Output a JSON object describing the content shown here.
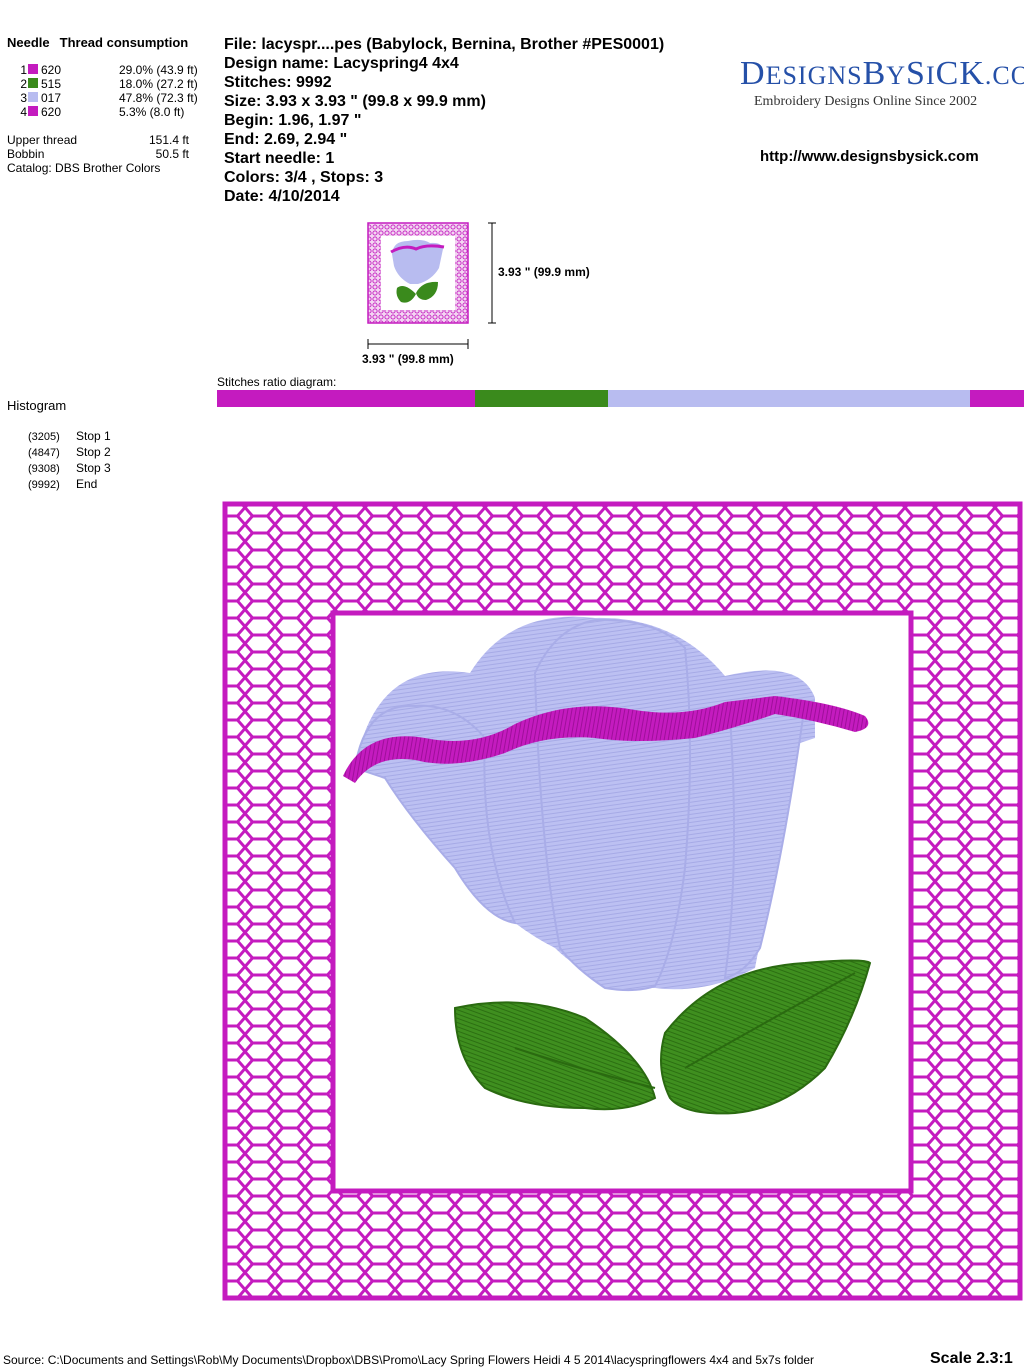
{
  "header": {
    "needle_label": "Needle",
    "consumption_label": "Thread consumption"
  },
  "threads": [
    {
      "num": "1",
      "code": "620",
      "pct": "29.0% (43.9 ft)",
      "color": "#c41bbf"
    },
    {
      "num": "2",
      "code": "515",
      "pct": "18.0% (27.2 ft)",
      "color": "#3a8a1c"
    },
    {
      "num": "3",
      "code": "017",
      "pct": "47.8% (72.3 ft)",
      "color": "#b8bcf0"
    },
    {
      "num": "4",
      "code": "620",
      "pct": "5.3% (8.0 ft)",
      "color": "#c41bbf"
    }
  ],
  "totals": {
    "upper_label": "Upper thread",
    "upper_value": "151.4 ft",
    "bobbin_label": "Bobbin",
    "bobbin_value": "50.5 ft",
    "catalog": "Catalog: DBS Brother Colors"
  },
  "info": {
    "file": "File: lacyspr....pes  (Babylock, Bernina, Brother #PES0001)",
    "design_name": "Design name: Lacyspring4 4x4",
    "stitches": "Stitches: 9992",
    "size": "Size: 3.93 x 3.93 \" (99.8 x 99.9 mm)",
    "begin": "Begin: 1.96, 1.97 \"",
    "end": "End: 2.69, 2.94 \"",
    "start_needle": "Start needle: 1",
    "colors": "Colors: 3/4 , Stops: 3",
    "date": "Date: 4/10/2014"
  },
  "logo": {
    "main_a": "D",
    "main_b": "ESIGNS",
    "main_c": "B",
    "main_d": "Y",
    "main_e": "S",
    "main_f": "I",
    "main_g": "CK",
    "main_h": ".COM",
    "tagline": "Embroidery Designs Online Since 2002"
  },
  "url": "http://www.designsbysick.com",
  "thumbnail": {
    "height_label": "3.93 \" (99.9 mm)",
    "width_label": "3.93 \" (99.8 mm)"
  },
  "ratio": {
    "label": "Stitches ratio diagram:",
    "segments": [
      {
        "share": 0.32,
        "color": "#c41bbf"
      },
      {
        "share": 0.165,
        "color": "#3a8a1c"
      },
      {
        "share": 0.448,
        "color": "#b8bcf0"
      },
      {
        "share": 0.067,
        "color": "#c41bbf"
      }
    ]
  },
  "histogram": {
    "title": "Histogram",
    "stops": [
      {
        "count": "(3205)",
        "label": "Stop 1"
      },
      {
        "count": "(4847)",
        "label": "Stop 2"
      },
      {
        "count": "(9308)",
        "label": "Stop 3"
      },
      {
        "count": "(9992)",
        "label": "End"
      }
    ]
  },
  "footer": {
    "source": "Source: C:\\Documents and Settings\\Rob\\My Documents\\Dropbox\\DBS\\Promo\\Lacy Spring Flowers   Heidi     4 5  2014\\lacyspringflowers 4x4 and 5x7s folder",
    "scale": "Scale 2.3:1"
  },
  "colors": {
    "purple": "#c41bbf",
    "green": "#3a8a1c",
    "lavender": "#b8bcf0"
  }
}
